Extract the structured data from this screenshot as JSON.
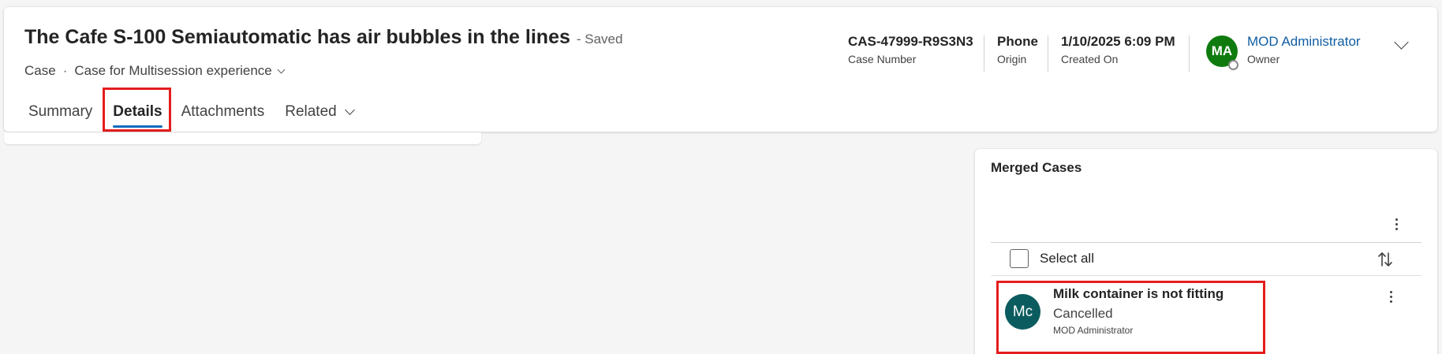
{
  "header": {
    "title": "The Cafe S-100 Semiautomatic has air bubbles in the lines",
    "save_status": "- Saved",
    "entity": "Case",
    "separator": "·",
    "form_name": "Case for Multisession experience",
    "fields": [
      {
        "value": "CAS-47999-R9S3N3",
        "label": "Case Number"
      },
      {
        "value": "Phone",
        "label": "Origin"
      },
      {
        "value": "1/10/2025 6:09 PM",
        "label": "Created On"
      }
    ],
    "owner": {
      "initials": "MA",
      "name": "MOD Administrator",
      "label": "Owner",
      "avatar_color": "#0f7b0f"
    }
  },
  "tabs": [
    {
      "label": "Summary",
      "active": false
    },
    {
      "label": "Details",
      "active": true
    },
    {
      "label": "Attachments",
      "active": false
    },
    {
      "label": "Related",
      "active": false,
      "has_dropdown": true
    }
  ],
  "merged_cases": {
    "title": "Merged Cases",
    "select_all_label": "Select all",
    "records": [
      {
        "initials": "Mc",
        "title": "Milk container is not fitting",
        "status": "Cancelled",
        "owner": "MOD Administrator",
        "avatar_color": "#0b5c5f"
      }
    ]
  },
  "icons": {
    "form_selector": "chevron-down-icon",
    "tab_related": "chevron-down-icon",
    "header_expand": "chevron-down-icon",
    "more": "more-vertical-icon",
    "sort": "sort-arrows-icon",
    "presence": "presence-offline-icon"
  },
  "colors": {
    "accent": "#0f6cbd",
    "link": "#115ea3",
    "highlight": "#e41d1d",
    "background": "#f5f5f5"
  }
}
